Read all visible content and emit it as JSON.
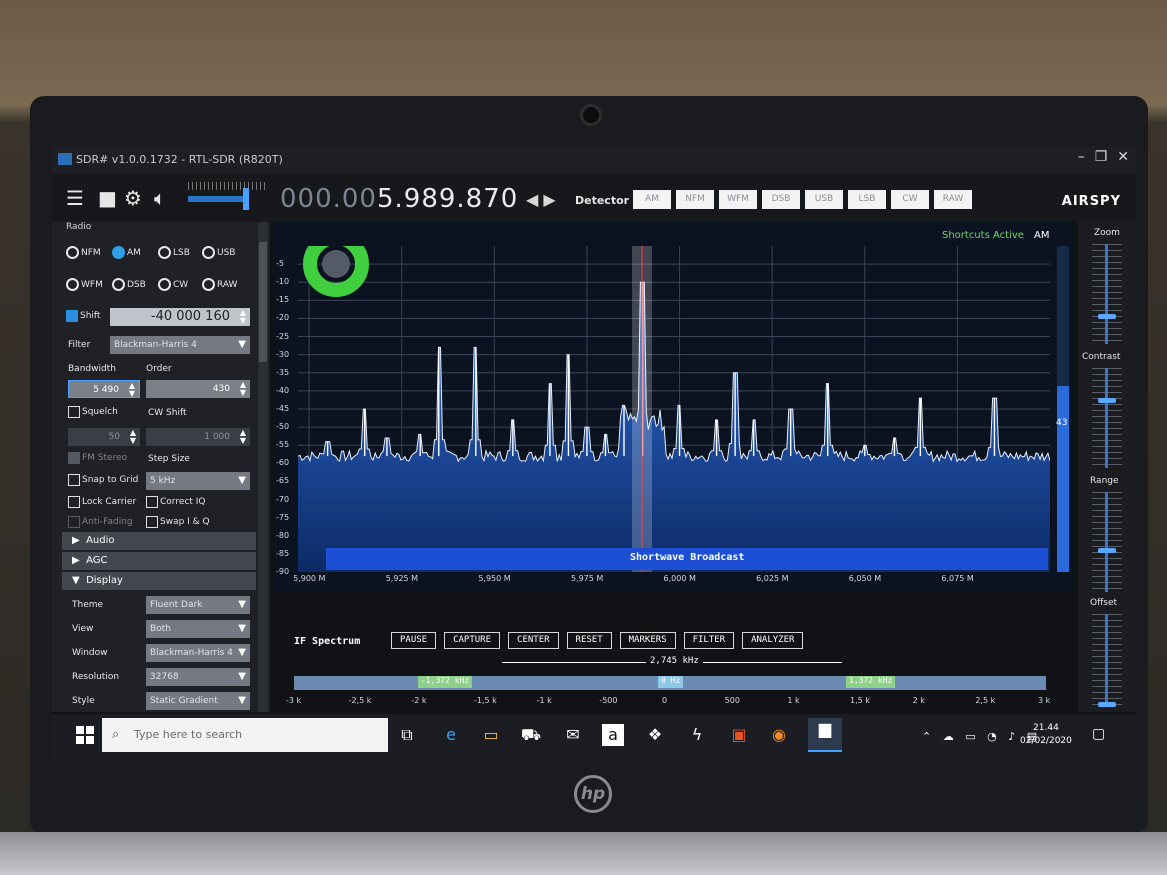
{
  "window": {
    "title": "SDR# v1.0.0.1732 - RTL-SDR (R820T)",
    "min": "–",
    "max": "❐",
    "close": "✕"
  },
  "toolbar": {
    "freq_dim": "000.00",
    "freq_bright": "5.989.870",
    "arrows": "◀ ▶",
    "detector_label": "Detector",
    "modes": [
      "AM",
      "NFM",
      "WFM",
      "DSB",
      "USB",
      "LSB",
      "CW",
      "RAW"
    ],
    "brand": "AIRSPY",
    "volume_level": 0.9
  },
  "radio": {
    "header": "Radio",
    "modes_row1": [
      "NFM",
      "AM",
      "LSB",
      "USB"
    ],
    "modes_row2": [
      "WFM",
      "DSB",
      "CW",
      "RAW"
    ],
    "selected_mode": "AM",
    "shift_label": "Shift",
    "shift_checked": true,
    "shift_value": "-40 000 160",
    "filter_label": "Filter",
    "filter_value": "Blackman-Harris 4",
    "bandwidth_label": "Bandwidth",
    "bandwidth_value": "5 490",
    "order_label": "Order",
    "order_value": "430",
    "squelch_label": "Squelch",
    "cwshift_label": "CW Shift",
    "squelch_value": "50",
    "cwshift_value": "1 000",
    "fmstereo_label": "FM Stereo",
    "stepsize_label": "Step Size",
    "snap_label": "Snap to Grid",
    "step_value": "5 kHz",
    "lockcarrier_label": "Lock Carrier",
    "correctiq_label": "Correct IQ",
    "antifading_label": "Anti-Fading",
    "swapiq_label": "Swap I & Q"
  },
  "sections": {
    "audio": "Audio",
    "agc": "AGC",
    "display": "Display"
  },
  "display": {
    "theme_label": "Theme",
    "theme_value": "Fluent Dark",
    "view_label": "View",
    "view_value": "Both",
    "window_label": "Window",
    "window_value": "Blackman-Harris 4",
    "resolution_label": "Resolution",
    "resolution_value": "32768",
    "style_label": "Style",
    "style_value": "Static Gradient"
  },
  "spectrum": {
    "shortcuts": "Shortcuts Active",
    "shortcuts_mode": "AM",
    "band_label": "Shortwave Broadcast",
    "level_value": "43",
    "level_fraction": 0.43
  },
  "chart_data": {
    "type": "line",
    "ylim": [
      -90,
      0
    ],
    "y_ticks": [
      "-5",
      "-10",
      "-15",
      "-20",
      "-25",
      "-30",
      "-35",
      "-40",
      "-45",
      "-50",
      "-55",
      "-60",
      "-65",
      "-70",
      "-75",
      "-80",
      "-85",
      "-90"
    ],
    "x_ticks": [
      "5,900 M",
      "5,925 M",
      "5,950 M",
      "5,975 M",
      "6,000 M",
      "6,025 M",
      "6,050 M",
      "6,075 M"
    ],
    "xlim": [
      5.897,
      6.1
    ],
    "tuned_mhz": 5.98987,
    "noise_floor_db": -58,
    "peaks": [
      {
        "x": 5.905,
        "y": -54
      },
      {
        "x": 5.915,
        "y": -45
      },
      {
        "x": 5.921,
        "y": -53
      },
      {
        "x": 5.93,
        "y": -52
      },
      {
        "x": 5.935,
        "y": -28
      },
      {
        "x": 5.945,
        "y": -28
      },
      {
        "x": 5.955,
        "y": -48
      },
      {
        "x": 5.965,
        "y": -38
      },
      {
        "x": 5.97,
        "y": -30
      },
      {
        "x": 5.975,
        "y": -50
      },
      {
        "x": 5.98,
        "y": -52
      },
      {
        "x": 5.985,
        "y": -44
      },
      {
        "x": 5.99,
        "y": -10
      },
      {
        "x": 6.0,
        "y": -44
      },
      {
        "x": 6.01,
        "y": -48
      },
      {
        "x": 6.015,
        "y": -35
      },
      {
        "x": 6.02,
        "y": -48
      },
      {
        "x": 6.03,
        "y": -45
      },
      {
        "x": 6.04,
        "y": -38
      },
      {
        "x": 6.05,
        "y": -55
      },
      {
        "x": 6.058,
        "y": -53
      },
      {
        "x": 6.065,
        "y": -42
      },
      {
        "x": 6.085,
        "y": -42
      }
    ]
  },
  "zoom_panel": {
    "zoom": "Zoom",
    "contrast": "Contrast",
    "range": "Range",
    "offset": "Offset",
    "zoom_level": 0.28,
    "contrast_level": 0.68,
    "range_level": 0.42,
    "offset_level": 0.02
  },
  "if_spectrum": {
    "title": "IF Spectrum",
    "buttons": [
      "PAUSE",
      "CAPTURE",
      "CENTER",
      "RESET",
      "MARKERS",
      "FILTER",
      "ANALYZER"
    ],
    "bandwidth": "2,745 kHz",
    "left_tag": "-1,372 kHz",
    "center_tag": "0 Hz",
    "right_tag": "1,372 kHz",
    "x_ticks": [
      "-3 k",
      "-2,5 k",
      "-2 k",
      "-1,5 k",
      "-1 k",
      "-500",
      "0",
      "500",
      "1 k",
      "1,5 k",
      "2 k",
      "2,5 k",
      "3 k"
    ]
  },
  "taskbar": {
    "search_placeholder": "Type here to search",
    "time": "21.44",
    "date": "02/02/2020",
    "tray": "⌃ ☁ ▭ ◔ ♪ ▤"
  }
}
